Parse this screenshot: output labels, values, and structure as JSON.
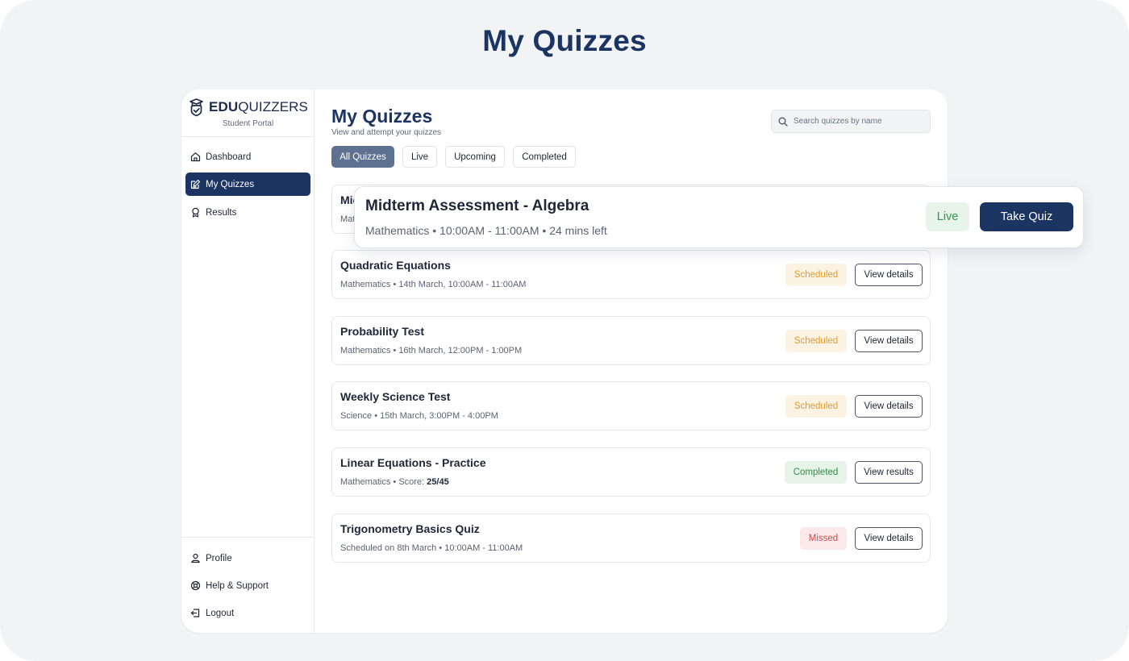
{
  "hero": {
    "title": "My Quizzes"
  },
  "brand": {
    "edu": "EDU",
    "quizzers": "QUIZZERS",
    "portal": "Student Portal"
  },
  "sidebar": {
    "items": [
      {
        "label": "Dashboard",
        "icon": "home-icon",
        "active": false
      },
      {
        "label": "My Quizzes",
        "icon": "quiz-edit-icon",
        "active": true
      },
      {
        "label": "Results",
        "icon": "award-icon",
        "active": false
      }
    ],
    "bottom_items": [
      {
        "label": "Profile",
        "icon": "user-icon"
      },
      {
        "label": "Help & Support",
        "icon": "lifebuoy-icon"
      },
      {
        "label": "Logout",
        "icon": "logout-icon"
      }
    ]
  },
  "main": {
    "title": "My Quizzes",
    "subtitle": "View and attempt your quizzes",
    "search": {
      "placeholder": "Search quizzes by name",
      "value": ""
    },
    "tabs": [
      {
        "label": "All Quizzes",
        "active": true
      },
      {
        "label": "Live",
        "active": false
      },
      {
        "label": "Upcoming",
        "active": false
      },
      {
        "label": "Completed",
        "active": false
      }
    ],
    "quizzes": [
      {
        "title": "Midterm Assessment - Algebra",
        "meta": "Mathematics • 10:00AM - 11:00AM • 24 mins left",
        "status": "Live",
        "action": "Take Quiz"
      },
      {
        "title": "Quadratic Equations",
        "meta": "Mathematics • 14th March, 10:00AM - 11:00AM",
        "status": "Scheduled",
        "action": "View details"
      },
      {
        "title": "Probability Test",
        "meta": "Mathematics • 16th March, 12:00PM - 1:00PM",
        "status": "Scheduled",
        "action": "View details"
      },
      {
        "title": "Weekly Science Test",
        "meta": "Science • 15th March, 3:00PM - 4:00PM",
        "status": "Scheduled",
        "action": "View details"
      },
      {
        "title": "Linear Equations - Practice",
        "meta_prefix": "Mathematics • Score: ",
        "score": "25/45",
        "status": "Completed",
        "action": "View results"
      },
      {
        "title": "Trigonometry Basics Quiz",
        "meta": "Scheduled on 8th March • 10:00AM - 11:00AM",
        "status": "Missed",
        "action": "View details"
      }
    ]
  },
  "colors": {
    "primary": "#1b3461",
    "scheduled": "#e09b2d",
    "completed": "#2f8a45",
    "missed": "#d24a4a",
    "live": "#35934d"
  }
}
